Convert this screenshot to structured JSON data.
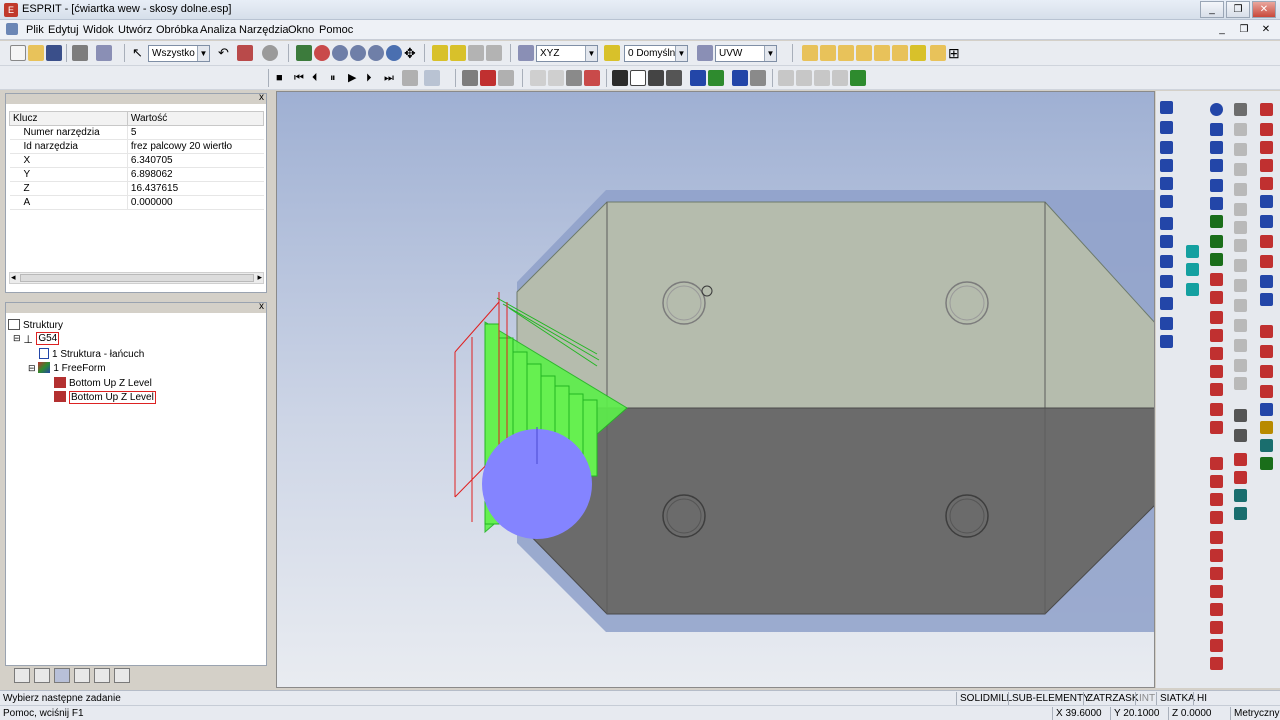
{
  "window": {
    "title": "ESPRIT - [ćwiartka wew - skosy dolne.esp]",
    "app_icon_text": "E",
    "minimize": "_",
    "restore": "❐",
    "close": "✕"
  },
  "menu": {
    "items": [
      "Plik",
      "Edytuj",
      "Widok",
      "Utwórz",
      "Obróbka",
      "Analiza",
      "Narzędzia",
      "Okno",
      "Pomoc"
    ],
    "mdi_minimize": "_",
    "mdi_restore": "❐",
    "mdi_close": "✕"
  },
  "toolbar": {
    "selection_filter": "Wszystko",
    "view_plane": "XYZ",
    "layer": "0 Domyśln",
    "work_plane": "UVW",
    "dropdown_arrow": "▼"
  },
  "properties": {
    "close": "x",
    "headers": [
      "Klucz",
      "Wartość"
    ],
    "rows": [
      {
        "key": "Numer narzędzia",
        "value": "5"
      },
      {
        "key": "Id narzędzia",
        "value": "frez palcowy 20 wiertło"
      },
      {
        "key": "X",
        "value": "6.340705"
      },
      {
        "key": "Y",
        "value": "6.898062"
      },
      {
        "key": "Z",
        "value": "16.437615"
      },
      {
        "key": "A",
        "value": "0.000000"
      }
    ],
    "scroll_left": "◂",
    "scroll_right": "▸"
  },
  "structure": {
    "close": "x",
    "root": "Struktury",
    "group": "G54",
    "items": [
      "1 Struktura - łańcuch",
      "1 FreeForm",
      "Bottom Up Z Level",
      "Bottom Up Z Level"
    ]
  },
  "status": {
    "prompt": "Wybierz następne zadanie",
    "help": "Pomoc, wciśnij F1",
    "modes": [
      "SOLIDMILL",
      "SUB-ELEMENTY",
      "ZATRZASK",
      "INT",
      "SIATKA",
      "HI"
    ],
    "x": "X 39.6000",
    "y": "Y 20.1000",
    "z": "Z 0.0000",
    "units": "Metryczny"
  },
  "colors": {
    "accent_highlight": "#d22222",
    "toolpath_green": "#5cf04a",
    "tool_blue": "#8484ff",
    "part_light": "#b5bcad",
    "part_dark": "#6b6b6b"
  }
}
